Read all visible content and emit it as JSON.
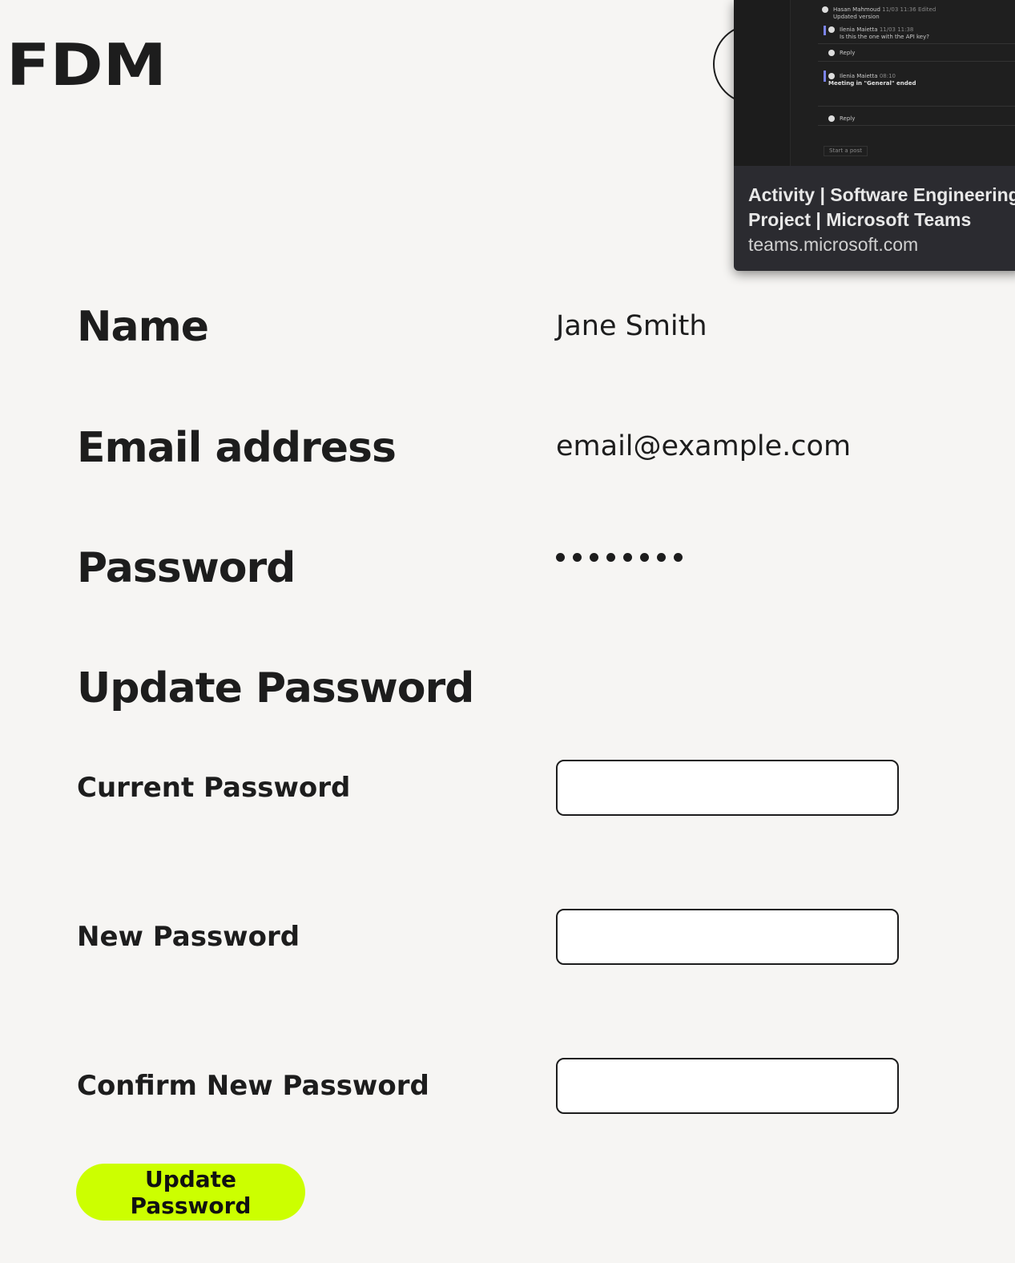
{
  "brand": {
    "logo_text": "FDM"
  },
  "profile": {
    "name_label": "Name",
    "name_value": "Jane Smith",
    "email_label": "Email address",
    "email_value": "email@example.com",
    "password_label": "Password",
    "password_mask_length": 8
  },
  "update_password": {
    "heading": "Update Password",
    "current_label": "Current Password",
    "current_value": "",
    "new_label": "New Password",
    "new_value": "",
    "confirm_label": "Confirm New Password",
    "confirm_value": "",
    "submit_label": "Update Password",
    "submit_color": "#ccff00"
  },
  "tab_preview": {
    "title_line1": "Activity | Software Engineering",
    "title_line2": "Project | Microsoft Teams",
    "url": "teams.microsoft.com",
    "thumbnail": {
      "messages": [
        {
          "author": "Hasan Mahmoud",
          "time": "11/03 11:36",
          "tag": "Edited",
          "text": "Updated version"
        },
        {
          "author": "Ilenia Maietta",
          "time": "11/03 11:38",
          "text": "Is this the one with the API key?"
        },
        {
          "reply": "Reply"
        },
        {
          "author": "Ilenia Maietta",
          "time": "08:10",
          "text": "Meeting in \"General\" ended"
        },
        {
          "reply": "Reply"
        }
      ],
      "start_post": "Start a post"
    }
  }
}
